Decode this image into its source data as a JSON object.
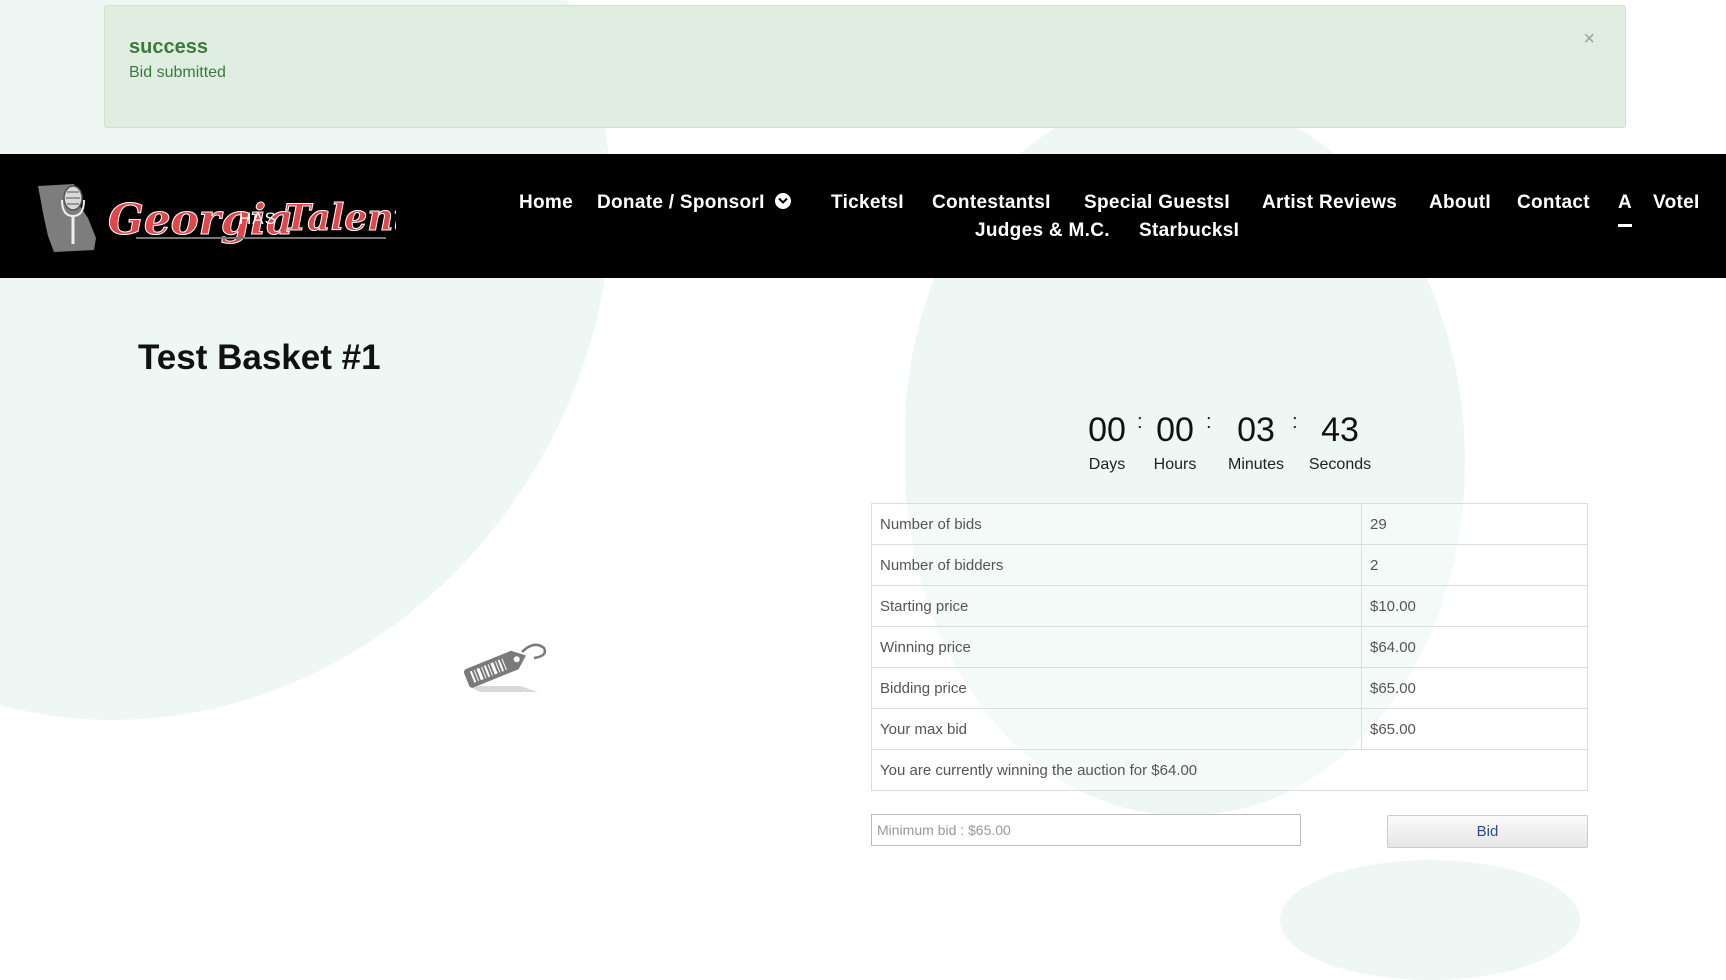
{
  "alert": {
    "title": "success",
    "message": "Bid submitted",
    "close": "×"
  },
  "brand": {
    "logo_text_1": "Georgia",
    "logo_text_2": "HAS",
    "logo_text_3": "Talent"
  },
  "nav": {
    "items": [
      "Home",
      "Donate / SponsorI",
      "TicketsI",
      "ContestantsI",
      "Special GuestsI",
      "Artist Reviews",
      "AboutI",
      "Contact",
      "A",
      "VoteI",
      "Judges & M.C.",
      "StarbucksI"
    ]
  },
  "page": {
    "title": "Test Basket #1"
  },
  "countdown": {
    "days": "00",
    "hours": "00",
    "minutes": "03",
    "seconds": "43",
    "labels": {
      "days": "Days",
      "hours": "Hours",
      "minutes": "Minutes",
      "seconds": "Seconds"
    },
    "separator": ":"
  },
  "auction": {
    "rows": [
      {
        "label": "Number of bids",
        "value": "29"
      },
      {
        "label": "Number of bidders",
        "value": "2"
      },
      {
        "label": "Starting price",
        "value": "$10.00"
      },
      {
        "label": "Winning price",
        "value": "$64.00"
      },
      {
        "label": "Bidding price",
        "value": "$65.00"
      },
      {
        "label": "Your max bid",
        "value": "$65.00"
      }
    ],
    "status": "You are currently winning the auction for $64.00"
  },
  "bid_form": {
    "placeholder": "Minimum bid : $65.00",
    "button": "Bid"
  },
  "colors": {
    "navbar": "#000000",
    "alert_bg": "#dfeee0",
    "alert_text": "#3c7a3c",
    "logo_red": "#e2454a"
  }
}
